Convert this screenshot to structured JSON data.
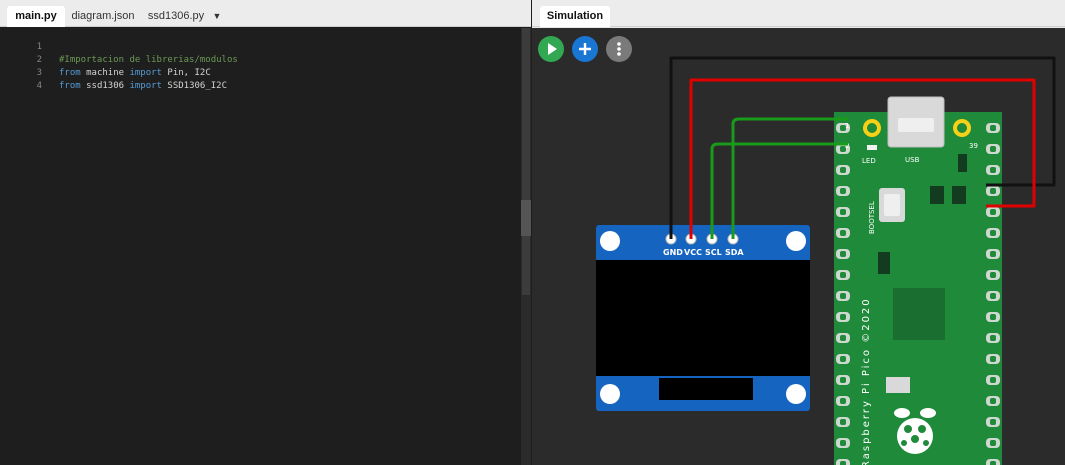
{
  "editor": {
    "tabs": [
      {
        "label": "main.py"
      },
      {
        "label": "diagram.json"
      },
      {
        "label": "ssd1306.py"
      }
    ],
    "tab_menu_icon": "▼",
    "lines": [
      {
        "number": "1",
        "comment": "#Importacion de librerias/modulos"
      },
      {
        "number": "2",
        "kw1": "from",
        "mod": " machine ",
        "kw2": "import",
        "rest": " Pin, I2C"
      },
      {
        "number": "3",
        "kw1": "from",
        "mod": " ssd1306 ",
        "kw2": "import",
        "rest": " SSD1306_I2C"
      },
      {
        "number": "4"
      }
    ]
  },
  "simulation": {
    "tab_label": "Simulation",
    "buttons": {
      "play_icon": "play-icon",
      "add_icon": "plus-icon",
      "more_icon": "more-vertical-icon"
    },
    "oled": {
      "pins": [
        "GND",
        "VCC",
        "SCL",
        "SDA"
      ]
    },
    "pico": {
      "pin_top_left_1": "1",
      "pin_top_left_2": "2",
      "pin_top_right": "39",
      "led_label": "LED",
      "usb_label": "USB",
      "bootsel_label": "BOOTSEL",
      "vertical_text": "Raspberry Pi Pico  ©2020"
    },
    "wire_colors": {
      "gnd": "#111111",
      "vcc": "#e00000",
      "signal": "#1a9a1a"
    },
    "board_color": "#1e8a3a",
    "oled_color": "#1565c0"
  }
}
